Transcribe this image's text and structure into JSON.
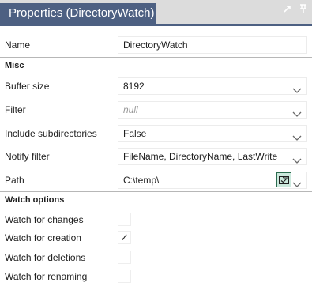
{
  "window": {
    "title": "Properties (DirectoryWatch)",
    "icons": [
      "pin-icon",
      "dock-pin-icon"
    ]
  },
  "properties": {
    "name": {
      "label": "Name",
      "value": "DirectoryWatch"
    },
    "sections": {
      "misc": "Misc",
      "watch_options": "Watch options"
    },
    "misc": {
      "buffer_size": {
        "label": "Buffer size",
        "value": "8192"
      },
      "filter": {
        "label": "Filter",
        "value": "null"
      },
      "include_subdirectories": {
        "label": "Include subdirectories",
        "value": "False"
      },
      "notify_filter": {
        "label": "Notify filter",
        "value": "FileName, DirectoryName, LastWrite"
      },
      "path": {
        "label": "Path",
        "value": "C:\\temp\\"
      }
    },
    "watch_options": {
      "watch_for_changes": {
        "label": "Watch for changes",
        "checked": false
      },
      "watch_for_creation": {
        "label": "Watch for creation",
        "checked": true,
        "mark": "✓"
      },
      "watch_for_deletions": {
        "label": "Watch for deletions",
        "checked": false
      },
      "watch_for_renaming": {
        "label": "Watch for renaming",
        "checked": false
      }
    }
  },
  "colors": {
    "accent": "#4d6082",
    "folder_button": "#cbe8dc"
  }
}
